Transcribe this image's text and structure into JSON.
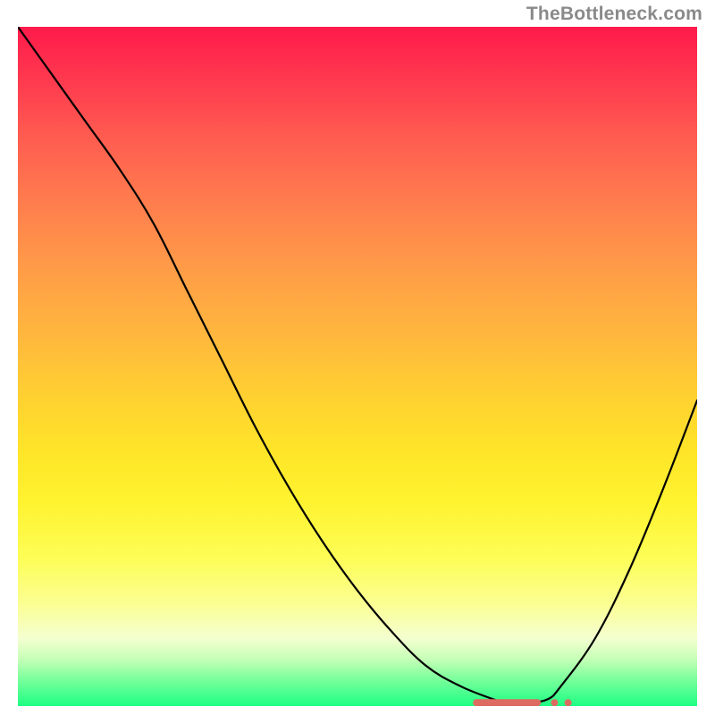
{
  "attribution": "TheBottleneck.com",
  "colors": {
    "curve": "#000000",
    "marker": "#dd6b62",
    "gradient_top": "#ff1a4b",
    "gradient_bottom": "#1dff83"
  },
  "chart_data": {
    "type": "line",
    "title": "",
    "xlabel": "",
    "ylabel": "",
    "xlim": [
      0,
      100
    ],
    "ylim": [
      0,
      100
    ],
    "x": [
      0,
      5,
      10,
      15,
      20,
      25,
      30,
      35,
      40,
      45,
      50,
      55,
      60,
      65,
      70,
      72,
      75,
      78,
      80,
      85,
      90,
      95,
      100
    ],
    "y": [
      100,
      93,
      86,
      79,
      71,
      61,
      51,
      41,
      32,
      24,
      17,
      11,
      6,
      3,
      1,
      0.5,
      0.5,
      1,
      3,
      10,
      20,
      32,
      45
    ],
    "trough_x_range": [
      67,
      80
    ],
    "trough_y": 0.5,
    "marker_points_x": [
      68,
      70,
      72,
      74,
      76,
      79
    ]
  }
}
